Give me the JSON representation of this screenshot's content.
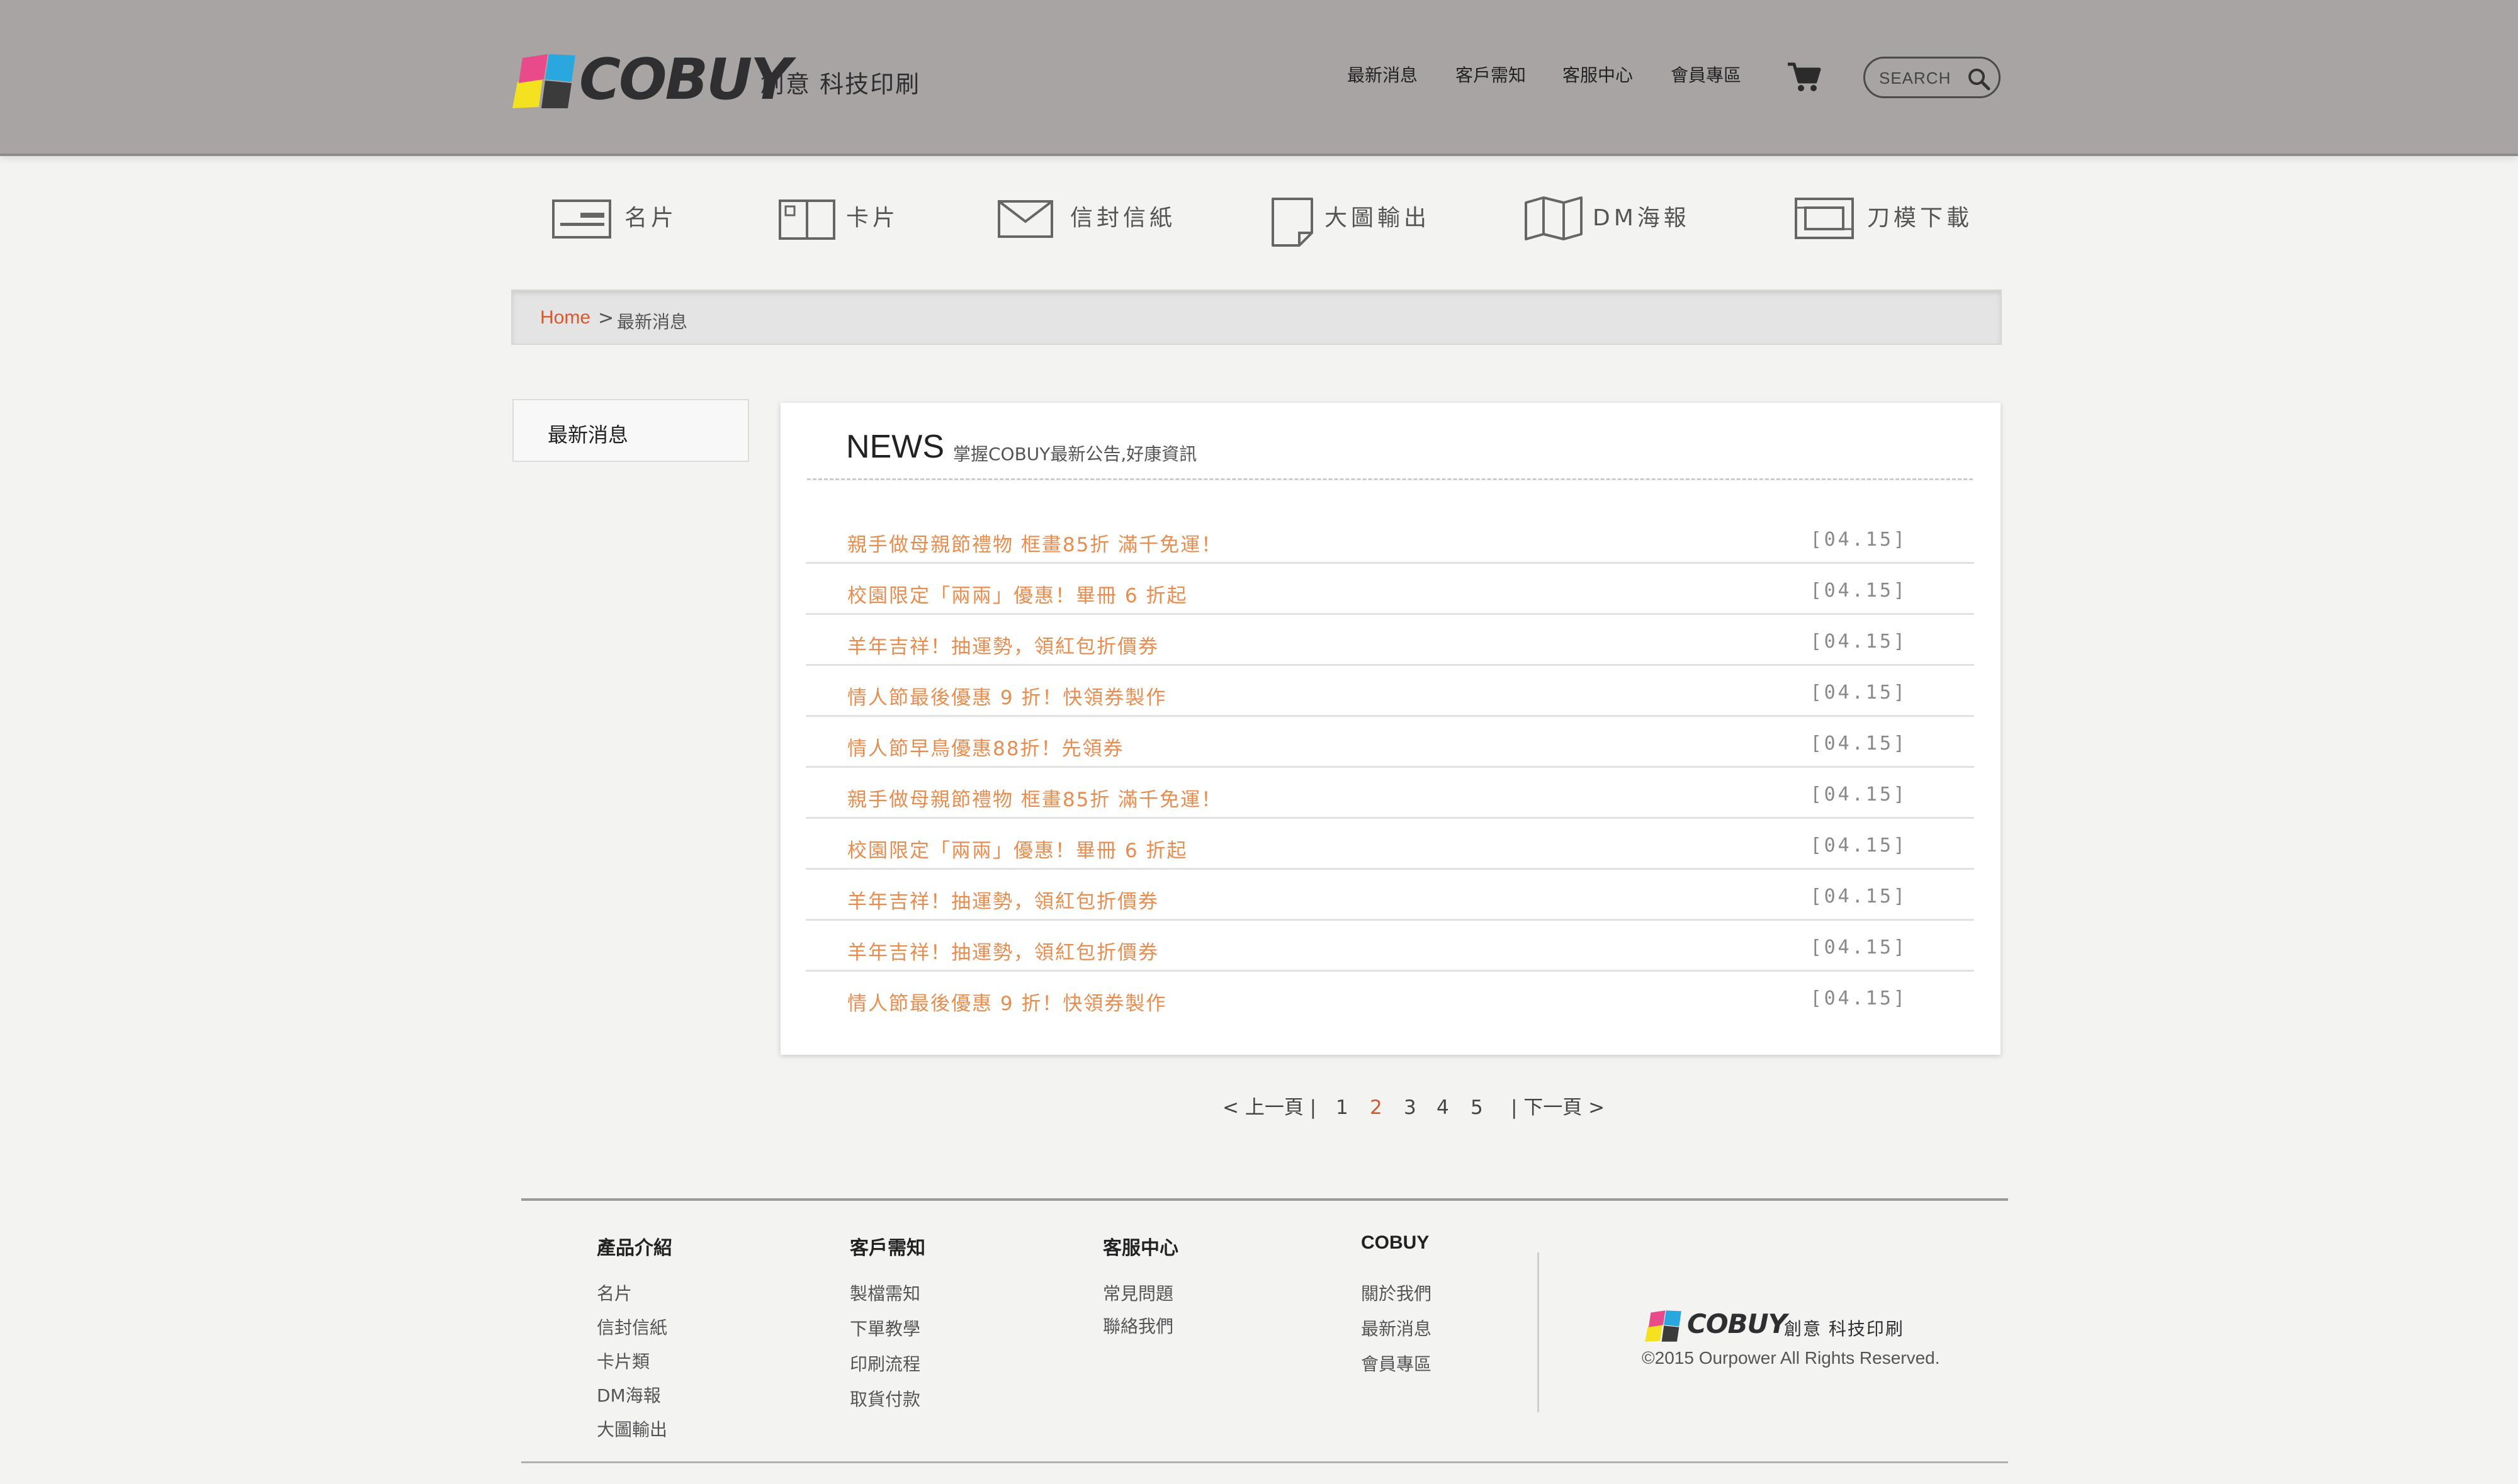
{
  "brand": {
    "name": "COBUY",
    "tagline": "創意 科技印刷"
  },
  "topnav": {
    "items": [
      "最新消息",
      "客戶需知",
      "客服中心",
      "會員專區"
    ]
  },
  "search": {
    "placeholder": "SEARCH"
  },
  "categories": [
    {
      "label": "名片",
      "icon": "business-card-icon"
    },
    {
      "label": "卡片",
      "icon": "card-icon"
    },
    {
      "label": "信封信紙",
      "icon": "envelope-icon"
    },
    {
      "label": "大圖輸出",
      "icon": "large-print-icon"
    },
    {
      "label": "DM海報",
      "icon": "brochure-icon"
    },
    {
      "label": "刀模下載",
      "icon": "die-cut-icon"
    }
  ],
  "breadcrumb": {
    "home": "Home",
    "separator": ">",
    "current": "最新消息"
  },
  "sidebar": {
    "items": [
      "最新消息"
    ]
  },
  "news": {
    "title": "NEWS",
    "subtitle": "掌握COBUY最新公告,好康資訊",
    "items": [
      {
        "title": "親手做母親節禮物 框畫85折 滿千免運！",
        "date": "[04.15]"
      },
      {
        "title": "校園限定「兩兩」優惠！畢冊 6 折起",
        "date": "[04.15]"
      },
      {
        "title": "羊年吉祥！抽運勢，領紅包折價券",
        "date": "[04.15]"
      },
      {
        "title": "情人節最後優惠 9 折！快領券製作",
        "date": "[04.15]"
      },
      {
        "title": "情人節早鳥優惠88折！先領券",
        "date": "[04.15]"
      },
      {
        "title": "親手做母親節禮物 框畫85折 滿千免運！",
        "date": "[04.15]"
      },
      {
        "title": "校園限定「兩兩」優惠！畢冊 6 折起",
        "date": "[04.15]"
      },
      {
        "title": "羊年吉祥！抽運勢，領紅包折價券",
        "date": "[04.15]"
      },
      {
        "title": "羊年吉祥！抽運勢，領紅包折價券",
        "date": "[04.15]"
      },
      {
        "title": "情人節最後優惠 9 折！快領券製作",
        "date": "[04.15]"
      }
    ]
  },
  "pagination": {
    "prev": "< 上一頁 |",
    "pages": [
      "1",
      "2",
      "3",
      "4",
      "5"
    ],
    "current": "2",
    "next": "| 下一頁 >"
  },
  "footer": {
    "columns": [
      {
        "heading": "產品介紹",
        "links": [
          "名片",
          "信封信紙",
          "卡片類",
          "DM海報",
          "大圖輸出"
        ]
      },
      {
        "heading": "客戶需知",
        "links": [
          "製檔需知",
          "下單教學",
          "印刷流程",
          "取貨付款"
        ]
      },
      {
        "heading": "客服中心",
        "links": [
          "常見問題",
          "聯絡我們"
        ]
      },
      {
        "heading": "COBUY",
        "links": [
          "關於我們",
          "最新消息",
          "會員專區"
        ]
      }
    ],
    "brand_name": "COBUY",
    "brand_tagline": "創意 科技印刷",
    "copyright": "©2015 Ourpower All Rights Reserved."
  },
  "colors": {
    "header_bg": "#a8a4a3",
    "accent": "#d9572b",
    "news_link": "#e88d50",
    "page_bg": "#f3f3f2"
  }
}
